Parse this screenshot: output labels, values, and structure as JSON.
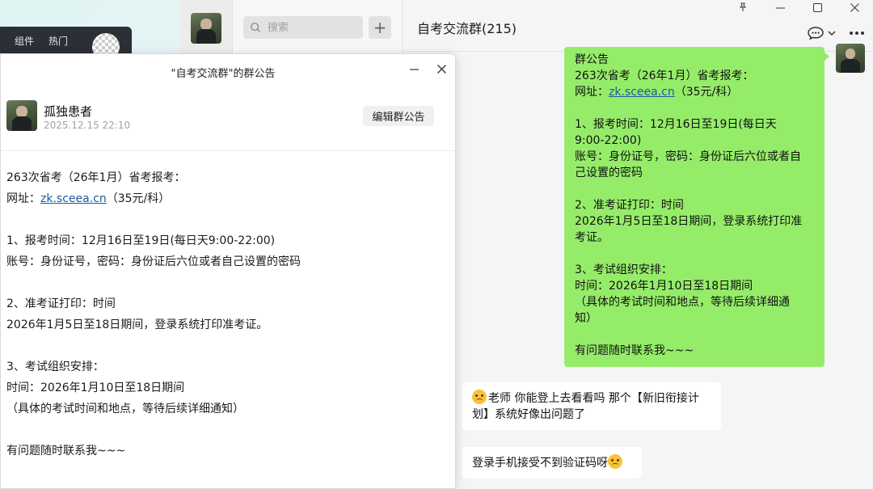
{
  "background_app": {
    "toolbar": [
      "组件",
      "热门"
    ]
  },
  "search": {
    "placeholder": "搜索"
  },
  "list": {
    "add_label": "+"
  },
  "chat": {
    "title": "自考交流群(215)",
    "window_controls": [
      "📌",
      "—",
      "☐",
      "✕"
    ],
    "self_message_lines": [
      "群公告",
      "263次省考（26年1月）省考报考：",
      "网址：",
      "",
      "1、报考时间：12月16日至19日(每日天",
      "9:00-22:00)",
      "账号：身份证号，密码：身份证后六位或者自",
      "己设置的密码",
      "",
      "2、准考证打印：时间",
      "2026年1月5日至18日期间，登录系统打印准",
      "考证。",
      "",
      "3、考试组织安排：",
      "时间：2026年1月10日至18日期间",
      "（具体的考试时间和地点，等待后续详细通",
      "知）",
      "",
      "有问题随时联系我~~~"
    ],
    "self_link": "zk.sceea.cn",
    "self_link_suffix": "（35元/科）",
    "messages": [
      {
        "text": "老师 你能登上去看看吗 那个【新旧衔接计划】系统好像出问题了"
      },
      {
        "text": "登录手机接受不到验证码呀"
      }
    ]
  },
  "announcement": {
    "title": "\"自考交流群\"的群公告",
    "author": "孤独患者",
    "date": "2025.12.15 22:10",
    "edit_label": "编辑群公告",
    "link": "zk.sceea.cn",
    "link_suffix": "（35元/科）",
    "lines": [
      "263次省考（26年1月）省考报考：",
      "网址：",
      "",
      "1、报考时间：12月16日至19日(每日天9:00-22:00)",
      "账号：身份证号，密码：身份证后六位或者自己设置的密码",
      "",
      "2、准考证打印：时间",
      "2026年1月5日至18日期间，登录系统打印准考证。",
      "",
      "3、考试组织安排：",
      "时间：2026年1月10日至18日期间",
      "（具体的考试时间和地点，等待后续详细通知）",
      "",
      "有问题随时联系我~~~"
    ]
  },
  "colors": {
    "bubble_self": "#95ec69",
    "bubble_other": "#ffffff",
    "link": "#1a5aa6"
  }
}
